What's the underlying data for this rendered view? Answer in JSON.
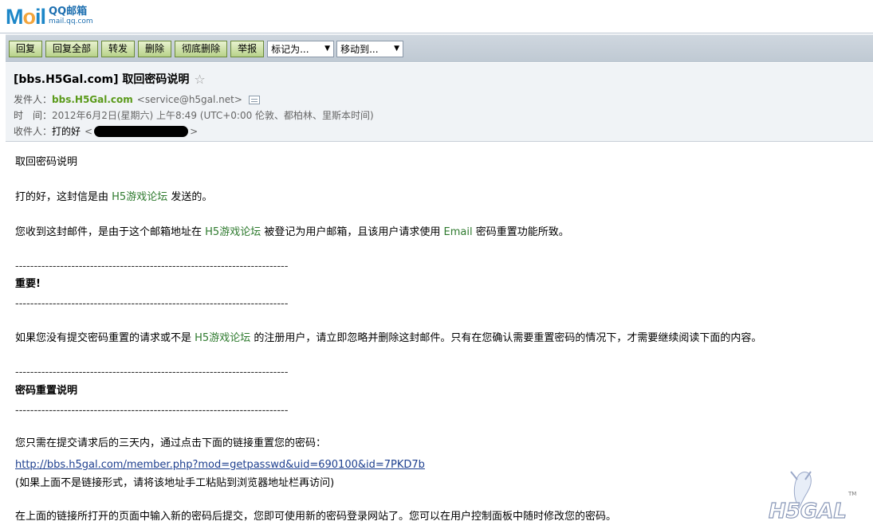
{
  "logo": {
    "word_m": "M",
    "word_o": "o",
    "word_il": "il",
    "qq": "QQ邮箱",
    "domain": "mail.qq.com"
  },
  "toolbar": {
    "reply": "回复",
    "reply_all": "回复全部",
    "forward": "转发",
    "delete": "删除",
    "delete_forever": "彻底删除",
    "report": "举报",
    "mark_as": "标记为...",
    "move_to": "移动到..."
  },
  "header": {
    "subject": "[bbs.H5Gal.com] 取回密码说明",
    "from_label": "发件人：",
    "from_name": "bbs.H5Gal.com",
    "from_email": "<service@h5gal.net>",
    "time_label": "时　间：",
    "time_value": "2012年6月2日(星期六) 上午8:49 (UTC+0:00 伦敦、都柏林、里斯本时间)",
    "to_label": "收件人：",
    "to_name": "打的好",
    "to_open": "<",
    "to_close": ">"
  },
  "body": {
    "title": "取回密码说明",
    "greet_a": "打的好，这封信是由",
    "forum": "H5游戏论坛",
    "greet_b": "发送的。",
    "reason_a": "您收到这封邮件，是由于这个邮箱地址在",
    "reason_b": "被登记为用户邮箱，且该用户请求使用",
    "email_word": "Email",
    "reason_c": "密码重置功能所致。",
    "dashes": "-------------------------------------------------------------------------",
    "important": "重要!",
    "warn_a": "如果您没有提交密码重置的请求或不是",
    "warn_b": "的注册用户，请立即忽略并删除这封邮件。只有在您确认需要重置密码的情况下，才需要继续阅读下面的内容。",
    "reset_title": "密码重置说明",
    "instr": "您只需在提交请求后的三天内，通过点击下面的链接重置您的密码：",
    "link": "http://bbs.h5gal.com/member.php?mod=getpasswd&uid=690100&id=7PKD7b",
    "note": "(如果上面不是链接形式，请将该地址手工粘贴到浏览器地址栏再访问)",
    "final": "在上面的链接所打开的页面中输入新的密码后提交，您即可使用新的密码登录网站了。您可以在用户控制面板中随时修改您的密码。"
  },
  "watermark": {
    "text": "H5GAL",
    "tm": "TM"
  },
  "colors": {
    "accent": "#1d87c8",
    "sender": "#5a9a1a",
    "link": "#1d3f8f",
    "forum": "#2e7a2e"
  }
}
